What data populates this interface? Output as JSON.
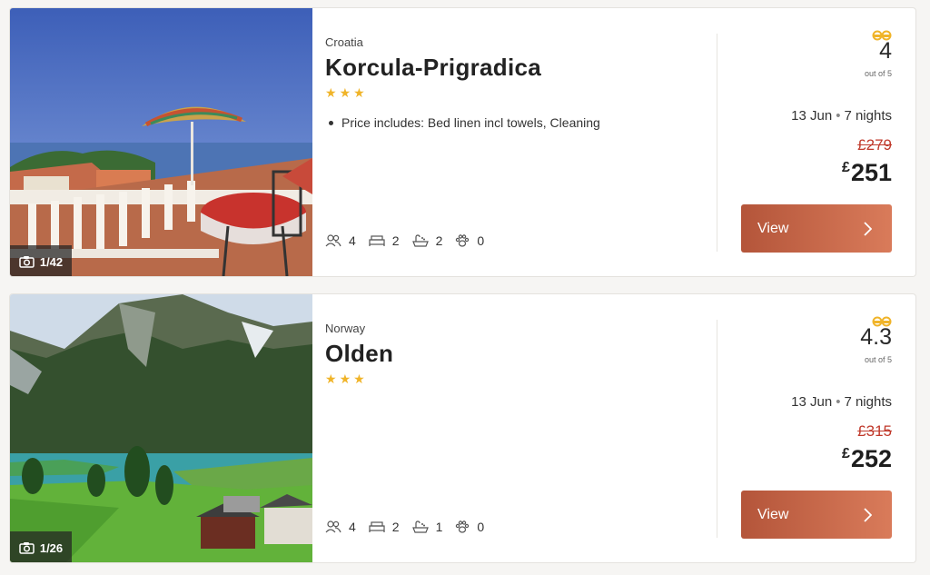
{
  "listings": [
    {
      "country": "Croatia",
      "name": "Korcula-Prigradica",
      "stars": 3,
      "features": [
        "Price includes: Bed linen incl towels, Cleaning"
      ],
      "photo_counter": "1/42",
      "amenities": {
        "guests": "4",
        "bedrooms": "2",
        "bathrooms": "2",
        "pets": "0"
      },
      "rating": "4",
      "rating_suffix": "out of 5",
      "date": "13 Jun",
      "nights": "7 nights",
      "old_price": "£279",
      "currency": "£",
      "price": "251",
      "button_label": "View"
    },
    {
      "country": "Norway",
      "name": "Olden",
      "stars": 3,
      "features": [],
      "photo_counter": "1/26",
      "amenities": {
        "guests": "4",
        "bedrooms": "2",
        "bathrooms": "1",
        "pets": "0"
      },
      "rating": "4.3",
      "rating_suffix": "out of 5",
      "date": "13 Jun",
      "nights": "7 nights",
      "old_price": "£315",
      "currency": "£",
      "price": "252",
      "button_label": "View"
    }
  ],
  "colors": {
    "accent_start": "#b4553a",
    "accent_end": "#d97b5a",
    "star": "#f0b429",
    "old_price": "#c0392b"
  },
  "icons": [
    "camera-icon",
    "guests-icon",
    "bed-icon",
    "bath-icon",
    "paw-icon",
    "reviews-icon",
    "chevron-right-icon"
  ]
}
